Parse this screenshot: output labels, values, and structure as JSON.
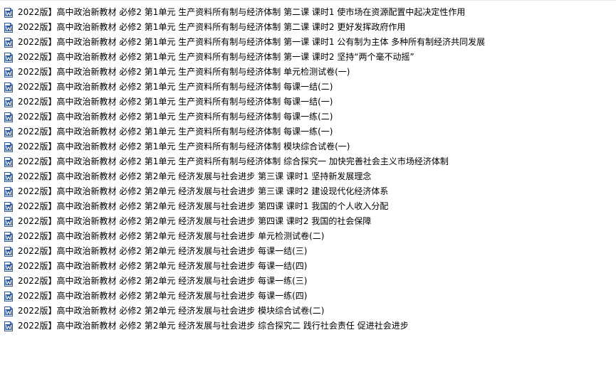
{
  "files": [
    {
      "name": "2022版】高中政治新教材 必修2  第1单元 生产资料所有制与经济体制  第二课 课时1 使市场在资源配置中起决定性作用",
      "icon": "word-doc-icon"
    },
    {
      "name": "2022版】高中政治新教材 必修2  第1单元 生产资料所有制与经济体制  第二课 课时2 更好发挥政府作用",
      "icon": "word-doc-icon"
    },
    {
      "name": "2022版】高中政治新教材 必修2  第1单元 生产资料所有制与经济体制  第一课 课时1 公有制为主体   多种所有制经济共同发展",
      "icon": "word-doc-icon"
    },
    {
      "name": "2022版】高中政治新教材 必修2  第1单元 生产资料所有制与经济体制  第一课 课时2 坚持“两个毫不动摇”",
      "icon": "word-doc-icon"
    },
    {
      "name": "2022版】高中政治新教材 必修2  第1单元 生产资料所有制与经济体制 单元检测试卷(一)",
      "icon": "word-doc-icon"
    },
    {
      "name": "2022版】高中政治新教材 必修2  第1单元 生产资料所有制与经济体制 每课一结(二)",
      "icon": "word-doc-icon"
    },
    {
      "name": "2022版】高中政治新教材 必修2  第1单元 生产资料所有制与经济体制 每课一结(一)",
      "icon": "word-doc-icon"
    },
    {
      "name": "2022版】高中政治新教材 必修2  第1单元 生产资料所有制与经济体制 每课一练(二)",
      "icon": "word-doc-icon"
    },
    {
      "name": "2022版】高中政治新教材 必修2  第1单元 生产资料所有制与经济体制 每课一练(一)",
      "icon": "word-doc-icon"
    },
    {
      "name": "2022版】高中政治新教材 必修2  第1单元 生产资料所有制与经济体制 模块综合试卷(一)",
      "icon": "word-doc-icon"
    },
    {
      "name": "2022版】高中政治新教材 必修2  第1单元 生产资料所有制与经济体制 综合探究一 加快完善社会主义市场经济体制",
      "icon": "word-doc-icon"
    },
    {
      "name": "2022版】高中政治新教材 必修2  第2单元 经济发展与社会进步  第三课 课时1 坚持新发展理念",
      "icon": "word-doc-icon"
    },
    {
      "name": "2022版】高中政治新教材 必修2  第2单元 经济发展与社会进步  第三课 课时2 建设现代化经济体系",
      "icon": "word-doc-icon"
    },
    {
      "name": "2022版】高中政治新教材 必修2  第2单元 经济发展与社会进步  第四课 课时1 我国的个人收入分配",
      "icon": "word-doc-icon"
    },
    {
      "name": "2022版】高中政治新教材 必修2  第2单元 经济发展与社会进步  第四课 课时2 我国的社会保障",
      "icon": "word-doc-icon"
    },
    {
      "name": "2022版】高中政治新教材 必修2  第2单元 经济发展与社会进步 单元检测试卷(二)",
      "icon": "word-doc-icon"
    },
    {
      "name": "2022版】高中政治新教材 必修2  第2单元 经济发展与社会进步 每课一结(三)",
      "icon": "word-doc-icon"
    },
    {
      "name": "2022版】高中政治新教材 必修2  第2单元 经济发展与社会进步 每课一结(四)",
      "icon": "word-doc-icon"
    },
    {
      "name": "2022版】高中政治新教材 必修2  第2单元 经济发展与社会进步 每课一练(三)",
      "icon": "word-doc-icon"
    },
    {
      "name": "2022版】高中政治新教材 必修2  第2单元 经济发展与社会进步 每课一练(四)",
      "icon": "word-doc-icon"
    },
    {
      "name": "2022版】高中政治新教材 必修2  第2单元 经济发展与社会进步 模块综合试卷(二)",
      "icon": "word-doc-icon"
    },
    {
      "name": "2022版】高中政治新教材 必修2  第2单元 经济发展与社会进步 综合探究二 践行社会责任    促进社会进步",
      "icon": "word-doc-icon"
    }
  ],
  "colors": {
    "icon_blue": "#2b579a",
    "icon_light": "#ffffff",
    "text": "#000000",
    "background": "#ffffff"
  }
}
